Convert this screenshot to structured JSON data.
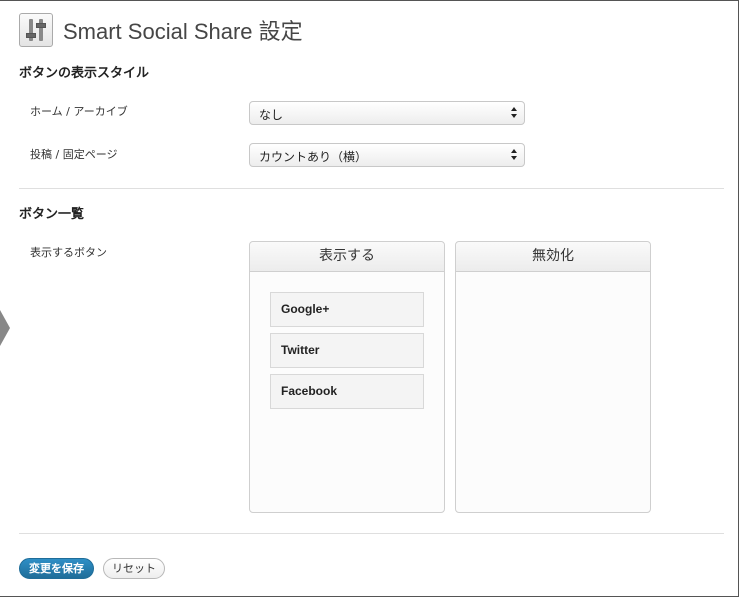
{
  "header": {
    "title": "Smart Social Share 設定",
    "icon": "settings-sliders-icon"
  },
  "display_style": {
    "section_title": "ボタンの表示スタイル",
    "rows": [
      {
        "label": "ホーム / アーカイブ",
        "selected": "なし"
      },
      {
        "label": "投稿 / 固定ページ",
        "selected": "カウントあり（横）"
      }
    ]
  },
  "button_list": {
    "section_title": "ボタン一覧",
    "row_label": "表示するボタン",
    "enabled_panel": {
      "title": "表示する",
      "items": [
        "Google+",
        "Twitter",
        "Facebook"
      ]
    },
    "disabled_panel": {
      "title": "無効化",
      "items": []
    }
  },
  "actions": {
    "save_label": "変更を保存",
    "reset_label": "リセット"
  },
  "colors": {
    "primary_button": "#2e8fc6",
    "title_text": "#464646"
  }
}
